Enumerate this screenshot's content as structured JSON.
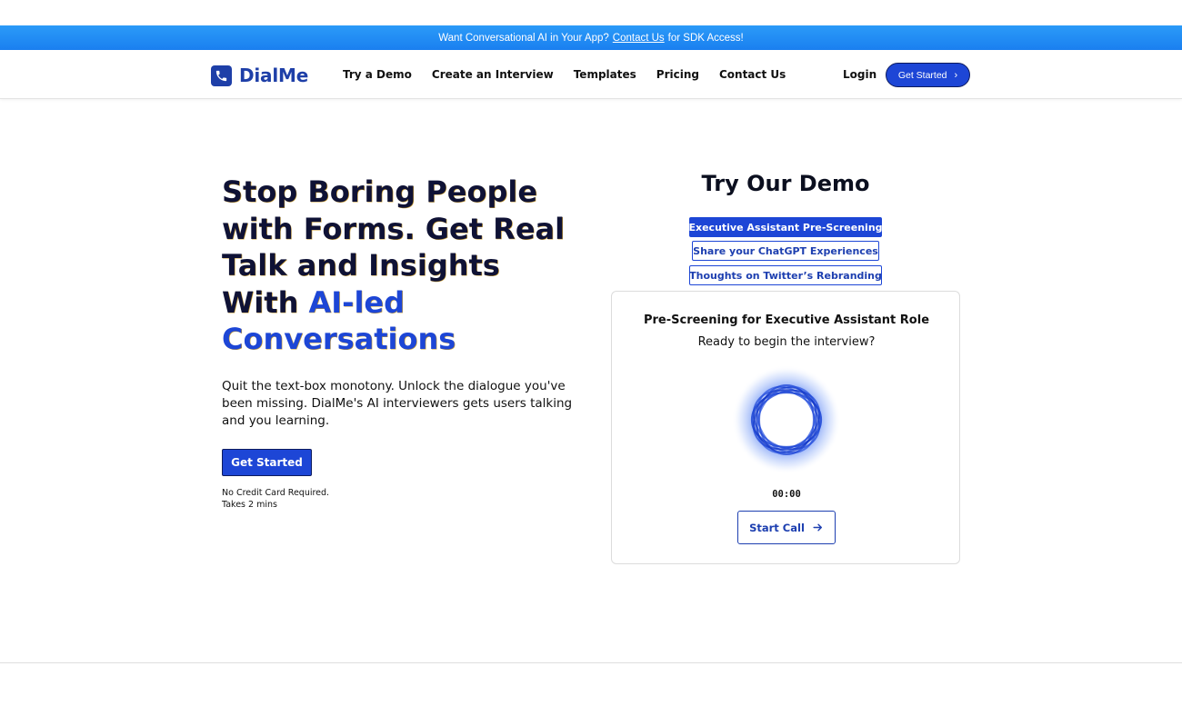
{
  "banner": {
    "prefix": "Want Conversational AI in Your App?",
    "link": "Contact Us",
    "suffix": "for SDK Access!"
  },
  "nav": {
    "logo_icon": "phone-icon",
    "logo_text": "DialMe",
    "links": [
      "Try a Demo",
      "Create an Interview",
      "Templates",
      "Pricing",
      "Contact Us"
    ],
    "login": "Login",
    "cta": "Get Started",
    "cta_icon": "chevron-right-icon"
  },
  "hero": {
    "title_plain": "Stop Boring People with Forms. Get Real Talk and Insights With",
    "title_accent": "AI-led Conversations",
    "subtitle": "Quit the text-box monotony. Unlock the dialogue you've been missing. DialMe's AI interviewers gets users talking and you learning.",
    "cta": "Get Started",
    "note1": "No Credit Card Required.",
    "note2": "Takes 2 mins"
  },
  "demo": {
    "title": "Try Our Demo",
    "options": [
      {
        "label": "Executive Assistant Pre-Screening",
        "active": true
      },
      {
        "label": "Share your ChatGPT Experiences",
        "active": false
      },
      {
        "label": "Thoughts on Twitter’s Rebranding",
        "active": false
      }
    ],
    "card": {
      "title": "Pre-Screening for Executive Assistant Role",
      "subtitle": "Ready to begin the interview?",
      "orb_icon": "voice-orb-icon",
      "timer": "00:00",
      "button": "Start Call",
      "button_icon": "arrow-right-icon"
    }
  },
  "colors": {
    "brand": "#1d46d6",
    "logo": "#1e3fa8",
    "banner": "#1a7ff0",
    "heading": "#0f1235"
  }
}
